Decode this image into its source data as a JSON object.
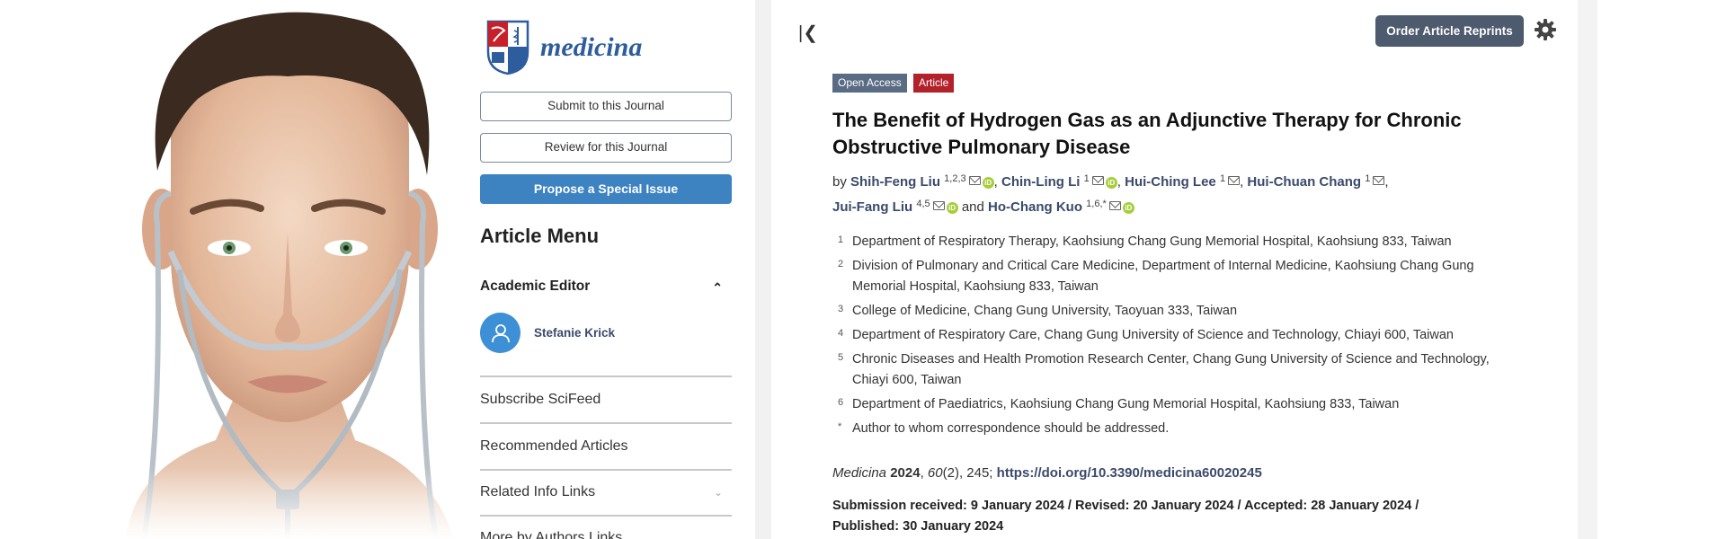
{
  "sidebar": {
    "journal_name": "medicina",
    "submit_label": "Submit to this Journal",
    "review_label": "Review for this Journal",
    "propose_label": "Propose a Special Issue",
    "menu_title": "Article Menu",
    "academic_editor_heading": "Academic Editor",
    "editor_name": "Stefanie Krick",
    "menu_items": [
      "Subscribe SciFeed",
      "Recommended Articles",
      "Related Info Links",
      "More by Authors Links"
    ]
  },
  "article": {
    "reprints_label": "Order Article Reprints",
    "badges": [
      "Open Access",
      "Article"
    ],
    "title": "The Benefit of Hydrogen Gas as an Adjunctive Therapy for Chronic Obstructive Pulmonary Disease",
    "by_label": "by",
    "and_label": "and",
    "authors": [
      {
        "name": "Shih-Feng Liu",
        "sup": "1,2,3"
      },
      {
        "name": "Chin-Ling Li",
        "sup": "1"
      },
      {
        "name": "Hui-Ching Lee",
        "sup": "1"
      },
      {
        "name": "Hui-Chuan Chang",
        "sup": "1"
      },
      {
        "name": "Jui-Fang Liu",
        "sup": "4,5"
      },
      {
        "name": "Ho-Chang Kuo",
        "sup": "1,6,*"
      }
    ],
    "affiliations": [
      {
        "num": "1",
        "text": "Department of Respiratory Therapy, Kaohsiung Chang Gung Memorial Hospital, Kaohsiung 833, Taiwan"
      },
      {
        "num": "2",
        "text": "Division of Pulmonary and Critical Care Medicine, Department of Internal Medicine, Kaohsiung Chang Gung Memorial Hospital, Kaohsiung 833, Taiwan"
      },
      {
        "num": "3",
        "text": "College of Medicine, Chang Gung University, Taoyuan 333, Taiwan"
      },
      {
        "num": "4",
        "text": "Department of Respiratory Care, Chang Gung University of Science and Technology, Chiayi 600, Taiwan"
      },
      {
        "num": "5",
        "text": "Chronic Diseases and Health Promotion Research Center, Chang Gung University of Science and Technology, Chiayi 600, Taiwan"
      },
      {
        "num": "6",
        "text": "Department of Paediatrics, Kaohsiung Chang Gung Memorial Hospital, Kaohsiung 833, Taiwan"
      },
      {
        "num": "*",
        "text": "Author to whom correspondence should be addressed."
      }
    ],
    "citation": {
      "journal": "Medicina",
      "year": "2024",
      "volume": "60",
      "issue_pages": "(2), 245;",
      "doi": "https://doi.org/10.3390/medicina60020245"
    },
    "dates": "Submission received: 9 January 2024 / Revised: 20 January 2024 / Accepted: 28 January 2024 / Published: 30 January 2024"
  },
  "colors": {
    "brand_blue": "#3d82c1",
    "open_access_badge": "#5a6b84",
    "article_badge": "#b3212b",
    "author_link": "#3b4a6b",
    "reprints_button": "#4e5a6e"
  }
}
